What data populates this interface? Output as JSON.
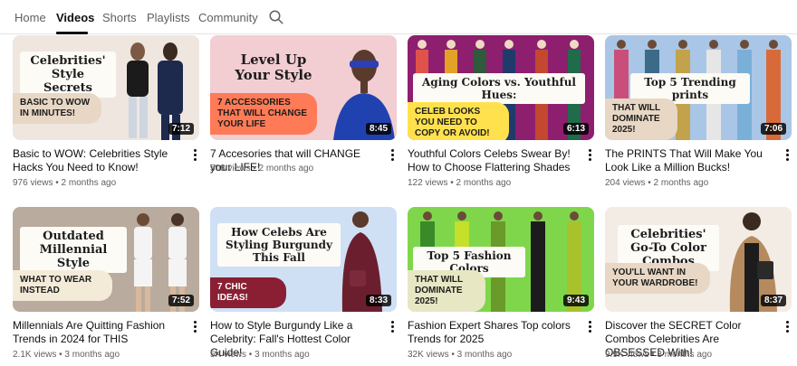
{
  "tabs": [
    {
      "label": "Home",
      "active": false
    },
    {
      "label": "Videos",
      "active": true
    },
    {
      "label": "Shorts",
      "active": false
    },
    {
      "label": "Playlists",
      "active": false
    },
    {
      "label": "Community",
      "active": false
    }
  ],
  "search_icon": "search-icon",
  "videos": [
    {
      "thumb_title": "Celebrities' Style Secrets",
      "thumb_sub": "Basic to WOW in minutes!",
      "duration": "7:12",
      "title": "Basic to WOW: Celebrities Style Hacks You Need to Know!",
      "views": "976 views",
      "age": "2 months ago",
      "bg": "#efe6e0"
    },
    {
      "thumb_title": "Level Up Your Style",
      "thumb_sub": "7 Accessories that will change your life",
      "duration": "8:45",
      "title": "7 Accesories that will CHANGE your LIFE!",
      "views": "508 views",
      "age": "2 months ago",
      "bg": "#f2cdd2"
    },
    {
      "thumb_title": "Aging Colors vs. Youthful Hues:",
      "thumb_sub": "Celeb looks you need to copy or avoid!",
      "duration": "6:13",
      "title": "Youthful Colors Celebs Swear By! How to Choose Flattering Shades",
      "views": "122 views",
      "age": "2 months ago",
      "bg": "#8e1f6e"
    },
    {
      "thumb_title": "Top 5 Trending prints",
      "thumb_sub": "That will dominate 2025!",
      "duration": "7:06",
      "title": "The PRINTS That Will Make You Look Like a Million Bucks!",
      "views": "204 views",
      "age": "2 months ago",
      "bg": "#a9c6e6"
    },
    {
      "thumb_title": "Outdated Millennial Style",
      "thumb_sub": "What to wear instead",
      "duration": "7:52",
      "title": "Millennials Are Quitting Fashion Trends in 2024 for THIS",
      "views": "2.1K views",
      "age": "3 months ago",
      "bg": "#b9ab9d"
    },
    {
      "thumb_title": "How Celebs Are Styling Burgundy This Fall",
      "thumb_sub": "7 chic ideas!",
      "duration": "8:33",
      "title": "How to Style Burgundy Like a Celebrity: Fall's Hottest Color Guide!",
      "views": "5K views",
      "age": "3 months ago",
      "bg": "#cfe0f5"
    },
    {
      "thumb_title": "Top 5 Fashion Colors",
      "thumb_sub": "That will dominate 2025!",
      "duration": "9:43",
      "title": "Fashion Expert Shares Top colors Trends for 2025",
      "views": "32K views",
      "age": "3 months ago",
      "bg": "#7fd64a"
    },
    {
      "thumb_title": "Celebrities' Go-To Color Combos",
      "thumb_sub": "You'll want in your wardrobe!",
      "duration": "8:37",
      "title": "Discover the SECRET Color Combos Celebrities Are OBSESSED With!",
      "views": "9.9K views",
      "age": "3 months ago",
      "bg": "#f3ece4"
    }
  ],
  "colors": {
    "sub_orange": "#ff7b57",
    "sub_beige": "#e7d7c4",
    "sub_yellow": "#ffe14d",
    "text_dark": "#0f0f0f",
    "text_muted": "#606060"
  }
}
